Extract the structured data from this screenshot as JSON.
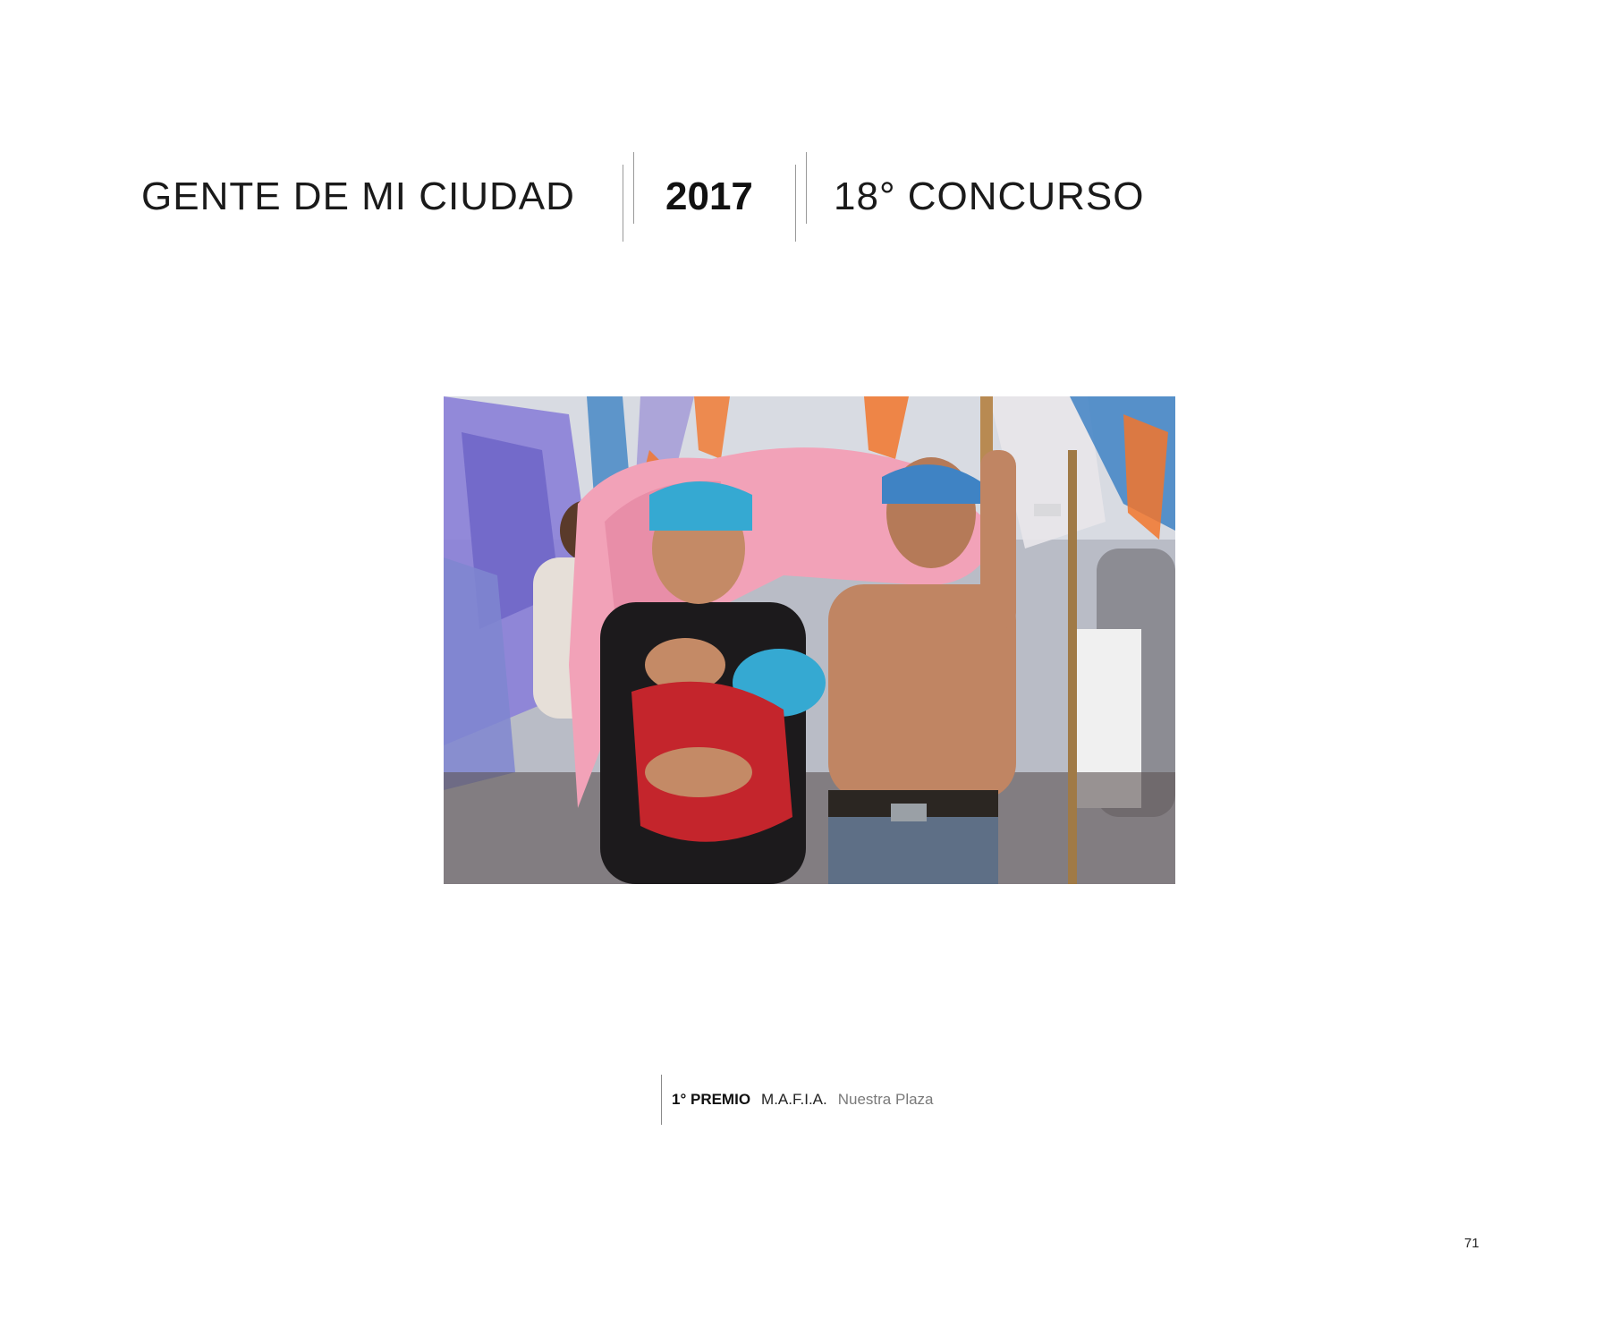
{
  "header": {
    "title": "GENTE DE MI CIUDAD",
    "year": "2017",
    "contest": "18° CONCURSO"
  },
  "photo": {
    "colors": {
      "pink_cloth": "#f2a2b8",
      "blue_scarf": "#35a9d2",
      "red_cloth": "#c4252c",
      "skin": "#c48a66",
      "flag_purple": "#8b7fd8",
      "flag_orange": "#f2762b",
      "flag_blue": "#3f83c4"
    }
  },
  "caption": {
    "prize": "1° PREMIO",
    "author": "M.A.F.I.A.",
    "title": "Nuestra Plaza"
  },
  "page_number": "71"
}
